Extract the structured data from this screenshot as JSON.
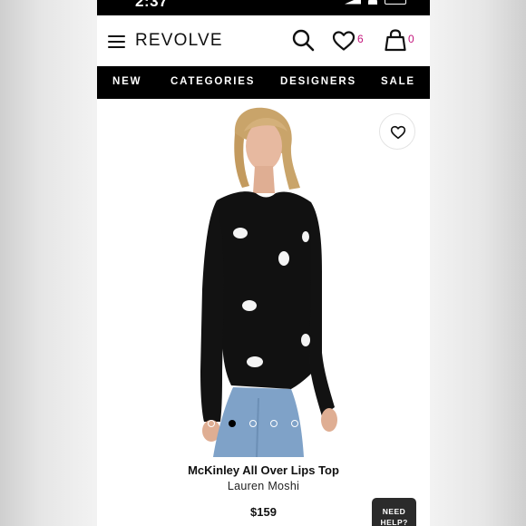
{
  "status_bar": {
    "time": "2:37"
  },
  "header": {
    "logo": "REVOLVE",
    "wishlist_count": "6",
    "bag_count": "0"
  },
  "nav": {
    "items": [
      {
        "label": "NEW"
      },
      {
        "label": "CATEGORIES"
      },
      {
        "label": "DESIGNERS"
      },
      {
        "label": "SALE"
      }
    ]
  },
  "gallery": {
    "image_count": 6,
    "active_index": 1
  },
  "product": {
    "name": "McKinley All Over Lips Top",
    "brand": "Lauren Moshi",
    "price": "$159"
  },
  "help": {
    "label": "NEED HELP?"
  },
  "colors": {
    "accent_count": "#c4167c",
    "nav_bg": "#000000"
  }
}
